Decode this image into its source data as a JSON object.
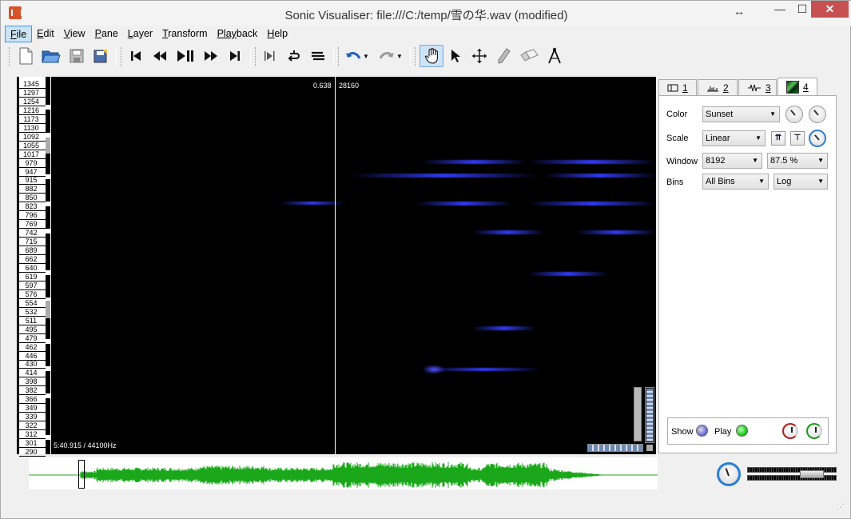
{
  "window": {
    "title": "Sonic Visualiser: file:///C:/temp/雪の华.wav (modified)",
    "minimize": "—",
    "maximize": "☐",
    "close": "✕"
  },
  "menu": [
    {
      "label": "File",
      "mnemonic": "F",
      "rest": "ile"
    },
    {
      "label": "Edit",
      "mnemonic": "E",
      "rest": "dit"
    },
    {
      "label": "View",
      "mnemonic": "V",
      "rest": "iew"
    },
    {
      "label": "Pane",
      "mnemonic": "P",
      "rest": "ane"
    },
    {
      "label": "Layer",
      "mnemonic": "L",
      "rest": "ayer"
    },
    {
      "label": "Transform",
      "mnemonic": "T",
      "rest": "ransform"
    },
    {
      "label": "Playback",
      "mnemonic": "Play",
      "rest": "back"
    },
    {
      "label": "Help",
      "mnemonic": "H",
      "rest": "elp"
    }
  ],
  "toolbar": {
    "icons": [
      "new-file-icon",
      "open-file-icon",
      "save-icon",
      "save-as-icon",
      "rewind-start-icon",
      "rewind-icon",
      "play-pause-icon",
      "fast-forward-icon",
      "fast-forward-end-icon",
      "constrain-playback-icon",
      "loop-icon",
      "solo-icon",
      "undo-icon",
      "redo-icon",
      "navigate-tool-icon",
      "select-tool-icon",
      "move-tool-icon",
      "draw-tool-icon",
      "erase-tool-icon",
      "measure-tool-icon"
    ],
    "active_tool": "navigate"
  },
  "pane": {
    "scale_labels": [
      "1345",
      "1297",
      "1254",
      "1216",
      "1173",
      "1130",
      "1092",
      "1055",
      "1017",
      "979",
      "947",
      "915",
      "882",
      "850",
      "823",
      "796",
      "769",
      "742",
      "715",
      "689",
      "662",
      "640",
      "619",
      "597",
      "576",
      "554",
      "532",
      "511",
      "495",
      "479",
      "462",
      "446",
      "430",
      "414",
      "398",
      "382",
      "366",
      "349",
      "339",
      "322",
      "312",
      "301",
      "290"
    ],
    "readout_value": "0.638",
    "readout_frame": "28160",
    "time_label": "5:40.915 / 44100Hz",
    "colors": {
      "background": "#000000",
      "spectrum": "#3c46ff"
    }
  },
  "tabs": [
    {
      "icon": "pane-icon",
      "num": "1"
    },
    {
      "icon": "waveform-bars-icon",
      "num": "2"
    },
    {
      "icon": "waveform-icon",
      "num": "3"
    },
    {
      "icon": "spectrogram-icon",
      "num": "4"
    }
  ],
  "properties": {
    "color_label": "Color",
    "color_value": "Sunset",
    "scale_label": "Scale",
    "scale_value": "Linear",
    "window_label": "Window",
    "window_value": "8192",
    "overlap_value": "87.5 %",
    "bins_label": "Bins",
    "bins_value": "All Bins",
    "bins_scale_value": "Log",
    "show_label": "Show",
    "play_label": "Play"
  },
  "overview": {
    "waveform_color": "#1aa81a"
  }
}
